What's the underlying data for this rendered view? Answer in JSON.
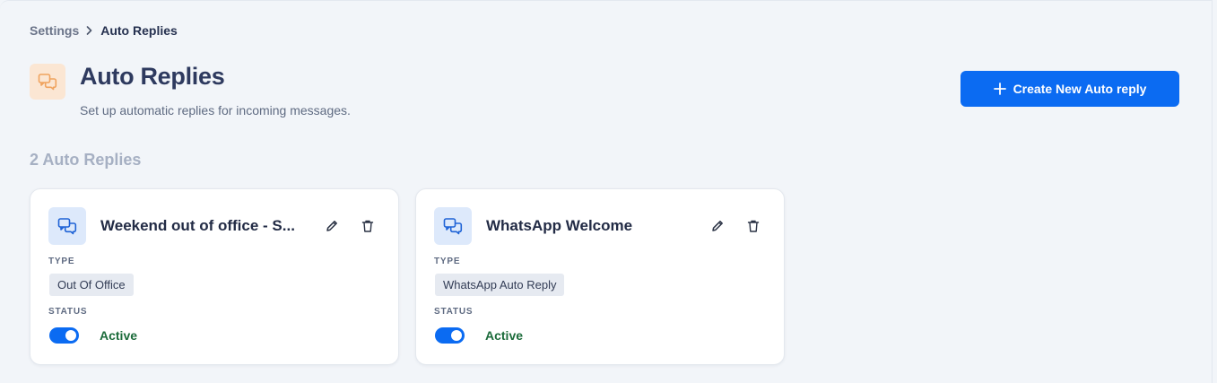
{
  "breadcrumb": {
    "parent": "Settings",
    "current": "Auto Replies"
  },
  "header": {
    "title": "Auto Replies",
    "subtitle": "Set up automatic replies for incoming messages.",
    "icon": "chat-bubbles-icon"
  },
  "actions": {
    "create_label": "Create New Auto reply"
  },
  "list": {
    "count_label": "2 Auto Replies"
  },
  "cards": [
    {
      "title": "Weekend out of office - S...",
      "type_label": "TYPE",
      "type_value": "Out Of Office",
      "status_label": "STATUS",
      "status_value": "Active",
      "enabled": true
    },
    {
      "title": "WhatsApp Welcome",
      "type_label": "TYPE",
      "type_value": "WhatsApp Auto Reply",
      "status_label": "STATUS",
      "status_value": "Active",
      "enabled": true
    }
  ],
  "colors": {
    "accent": "#0b6bf2",
    "header_icon_bg": "#fbe6d3",
    "header_icon": "#f0a35e",
    "card_icon_bg": "#dde9fb",
    "status_active": "#1b6b3a"
  }
}
